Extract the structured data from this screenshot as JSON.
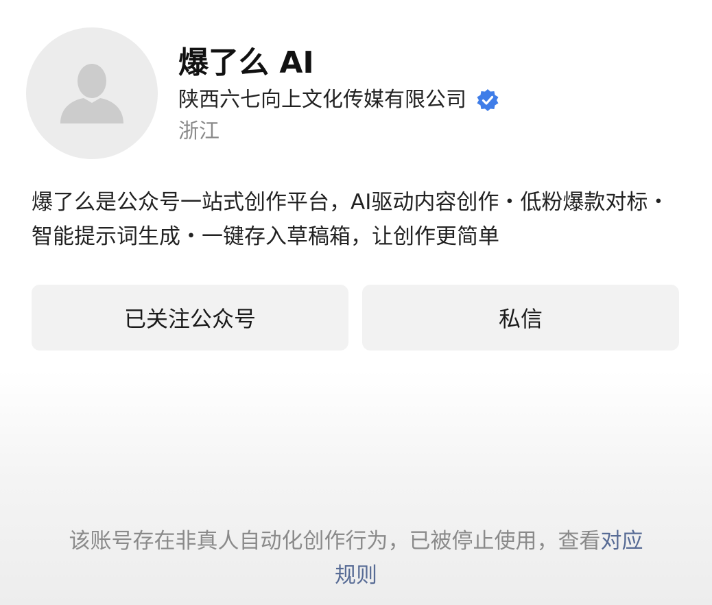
{
  "profile": {
    "avatar_icon": "default-user-avatar-icon",
    "name": "爆了么 AI",
    "company": "陕西六七向上文化传媒有限公司",
    "verified_icon": "verified-badge-icon",
    "verified_color": "#3f7de8",
    "region": "浙江",
    "description": "爆了么是公众号一站式创作平台，AI驱动内容创作・低粉爆款对标・智能提示词生成・一键存入草稿箱，让创作更简单"
  },
  "actions": {
    "follow_label": "已关注公众号",
    "message_label": "私信"
  },
  "notice": {
    "text": "该账号存在非真人自动化创作行为，已被停止使用，查看",
    "link_text": "对应规则",
    "link_color": "#576b95"
  }
}
